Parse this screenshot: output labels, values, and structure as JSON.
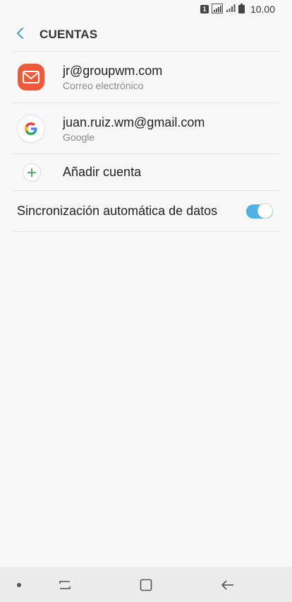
{
  "status_bar": {
    "sim_label": "1",
    "time": "10.00"
  },
  "header": {
    "title": "CUENTAS"
  },
  "accounts": [
    {
      "title": "jr@groupwm.com",
      "subtitle": "Correo electrónico",
      "icon": "email-icon"
    },
    {
      "title": "juan.ruiz.wm@gmail.com",
      "subtitle": "Google",
      "icon": "google-icon"
    }
  ],
  "add_account": {
    "label": "Añadir cuenta",
    "icon": "plus-icon"
  },
  "sync": {
    "label": "Sincronización automática de datos",
    "enabled": true
  },
  "nav_bar": {
    "items": [
      "dot-icon",
      "recent-apps-icon",
      "home-icon",
      "back-icon"
    ]
  },
  "colors": {
    "accent": "#4db2e6",
    "email_icon_bg": "#ee5a3a",
    "add_plus": "#3daa5c",
    "background": "#f8f8f8"
  }
}
